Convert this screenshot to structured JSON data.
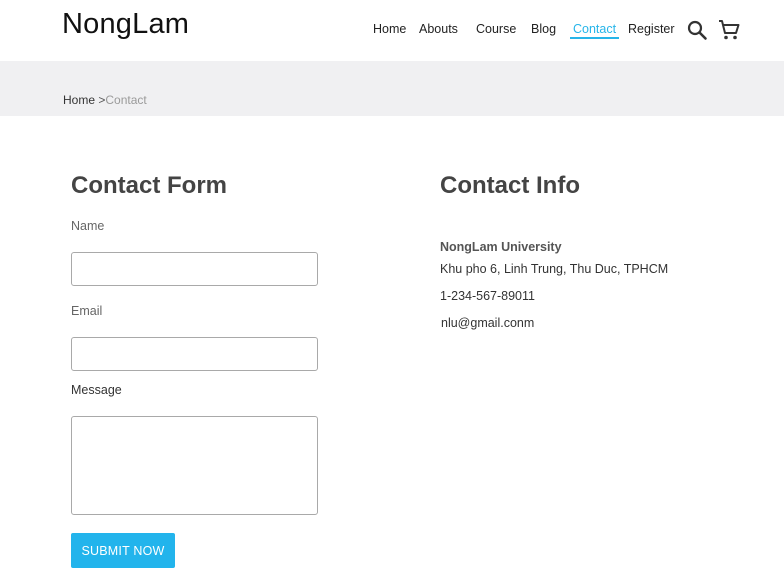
{
  "brand": "NongLam",
  "nav": {
    "items": [
      {
        "label": "Home"
      },
      {
        "label": "Abouts"
      },
      {
        "label": "Course"
      },
      {
        "label": "Blog"
      },
      {
        "label": "Contact",
        "active": true
      },
      {
        "label": "Register"
      }
    ],
    "icons": [
      "search-icon",
      "cart-icon"
    ]
  },
  "breadcrumb": {
    "home": "Home",
    "separator": ">",
    "current": "Contact"
  },
  "contact_form": {
    "title": "Contact Form",
    "name_label": "Name",
    "name_value": "",
    "email_label": "Email",
    "email_value": "",
    "message_label": "Message",
    "message_value": "",
    "submit_label": "SUBMIT NOW"
  },
  "contact_info": {
    "title": "Contact Info",
    "organization": "NongLam University",
    "address": "Khu pho 6, Linh Trung, Thu Duc, TPHCM",
    "phone": "1-234-567-89011",
    "email": "nlu@gmail.conm"
  },
  "colors": {
    "accent": "#27b5e9",
    "button": "#22b4ec",
    "band": "#f0f0f2"
  }
}
